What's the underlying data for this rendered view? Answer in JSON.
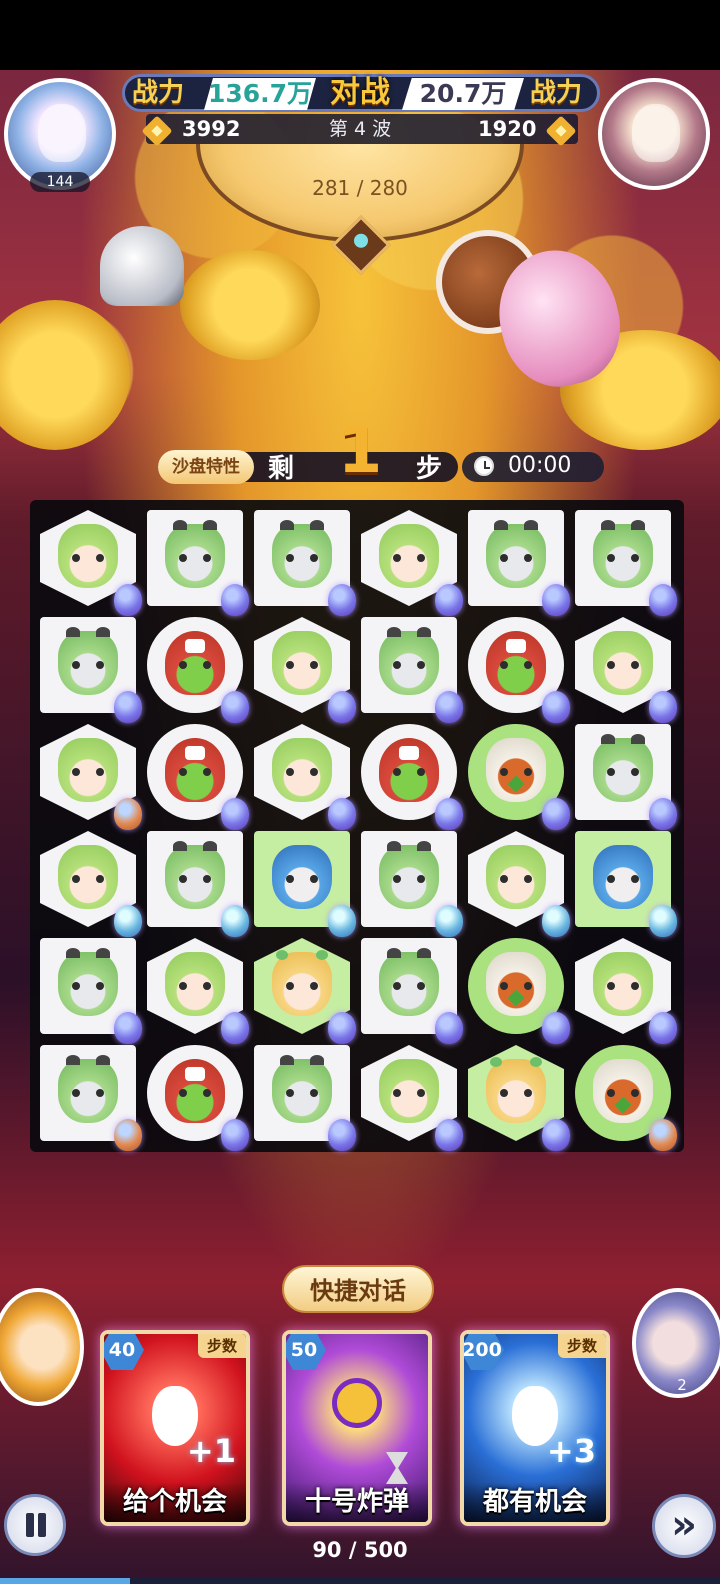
{
  "header": {
    "left_power_label": "战力",
    "left_power_value": "136.7万",
    "vs_label": "对战",
    "right_power_value": "20.7万",
    "right_power_label": "战力",
    "left_score": "3992",
    "wave": "第 4 波",
    "right_score": "1920",
    "player_level": "144",
    "boss_hp": "281 / 280"
  },
  "status": {
    "sandbox_label": "沙盘特性",
    "steps_label": "剩",
    "steps_count": "1",
    "steps_unit": "步",
    "timer": "00:00"
  },
  "board": {
    "rows": [
      [
        {
          "shape": "hex",
          "face": "girl",
          "egg": "purple"
        },
        {
          "shape": "square",
          "face": "zombie",
          "egg": "purple"
        },
        {
          "shape": "square",
          "face": "zombie",
          "egg": "purple"
        },
        {
          "shape": "hex",
          "face": "girl",
          "egg": "purple"
        },
        {
          "shape": "square",
          "face": "zombie",
          "egg": "purple"
        },
        {
          "shape": "square",
          "face": "zombie",
          "egg": "purple"
        }
      ],
      [
        {
          "shape": "square",
          "face": "zombie",
          "egg": "purple"
        },
        {
          "shape": "circle",
          "face": "goblin",
          "egg": "purple"
        },
        {
          "shape": "hex",
          "face": "girl",
          "egg": "purple"
        },
        {
          "shape": "square",
          "face": "zombie",
          "egg": "purple"
        },
        {
          "shape": "circle",
          "face": "goblin",
          "egg": "purple"
        },
        {
          "shape": "hex",
          "face": "girl",
          "egg": "purple"
        }
      ],
      [
        {
          "shape": "hex",
          "face": "girl",
          "egg": "orange"
        },
        {
          "shape": "circle",
          "face": "goblin",
          "egg": "purple"
        },
        {
          "shape": "hex",
          "face": "girl",
          "egg": "purple"
        },
        {
          "shape": "circle",
          "face": "goblin",
          "egg": "purple"
        },
        {
          "shape": "green-circle",
          "face": "bird",
          "egg": "purple"
        },
        {
          "shape": "square",
          "face": "zombie",
          "egg": "purple"
        }
      ],
      [
        {
          "shape": "hex",
          "face": "girl",
          "egg": "teal"
        },
        {
          "shape": "square",
          "face": "zombie",
          "egg": "teal"
        },
        {
          "shape": "green-square",
          "face": "blue",
          "egg": "teal"
        },
        {
          "shape": "square",
          "face": "zombie",
          "egg": "teal"
        },
        {
          "shape": "hex",
          "face": "girl",
          "egg": "teal"
        },
        {
          "shape": "green-square",
          "face": "blue",
          "egg": "teal"
        }
      ],
      [
        {
          "shape": "square",
          "face": "zombie",
          "egg": "purple"
        },
        {
          "shape": "hex",
          "face": "girl",
          "egg": "purple"
        },
        {
          "shape": "green-hex",
          "face": "blonde",
          "egg": "purple"
        },
        {
          "shape": "square",
          "face": "zombie",
          "egg": "purple"
        },
        {
          "shape": "green-circle",
          "face": "bird",
          "egg": "purple"
        },
        {
          "shape": "hex",
          "face": "girl",
          "egg": "purple"
        }
      ],
      [
        {
          "shape": "square",
          "face": "zombie",
          "egg": "orange"
        },
        {
          "shape": "circle",
          "face": "goblin",
          "egg": "purple"
        },
        {
          "shape": "square",
          "face": "zombie",
          "egg": "purple"
        },
        {
          "shape": "hex",
          "face": "girl",
          "egg": "purple"
        },
        {
          "shape": "green-hex",
          "face": "blonde",
          "egg": "purple"
        },
        {
          "shape": "green-circle",
          "face": "bird",
          "egg": "orange"
        }
      ]
    ]
  },
  "bottom": {
    "quick_chat": "快捷对话",
    "enemy_count": "2",
    "cards": [
      {
        "cost": "40",
        "tag": "步数",
        "title": "给个机会",
        "bonus": "+1",
        "icon": "footprint-icon"
      },
      {
        "cost": "50",
        "tag": "",
        "title": "十号炸弹",
        "bonus": "",
        "icon": "skull-bomb-icon"
      },
      {
        "cost": "200",
        "tag": "步数",
        "title": "都有机会",
        "bonus": "+3",
        "icon": "footprints-icon"
      }
    ],
    "progress_text": "90 / 500",
    "progress_fraction": 0.18,
    "fast_forward_glyph": "»"
  }
}
